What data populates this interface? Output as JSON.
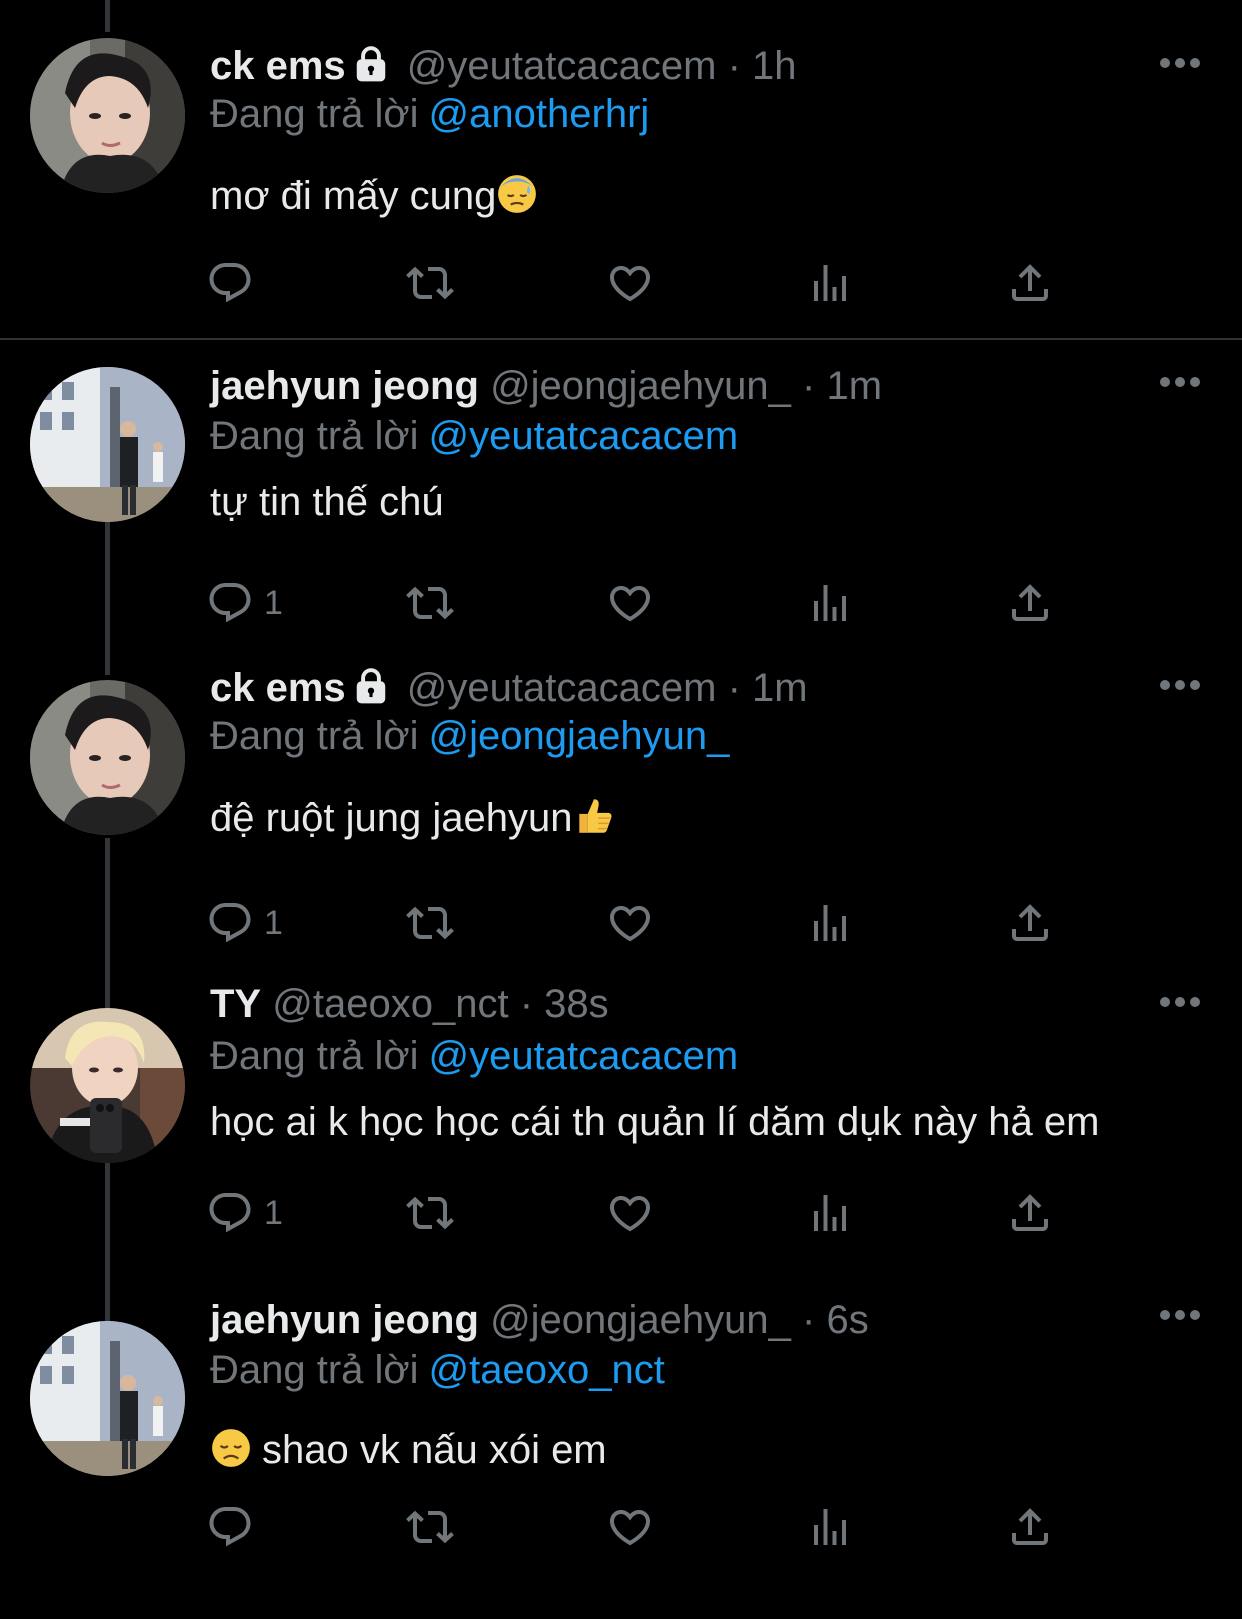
{
  "tweets": [
    {
      "name": "ck ems",
      "locked": true,
      "handle": "@yeutatcacacem",
      "sep": "·",
      "time": "1h",
      "reply_prefix": "Đang trả lời",
      "reply_to": "@anotherhrj",
      "text": "mơ đi mấy cung",
      "emoji": "sweat-face",
      "reply_count": ""
    },
    {
      "name": "jaehyun jeong",
      "locked": false,
      "handle": "@jeongjaehyun_",
      "sep": "·",
      "time": "1m",
      "reply_prefix": "Đang trả lời",
      "reply_to": "@yeutatcacacem",
      "text": "tự tin thế chú",
      "emoji": "",
      "reply_count": "1"
    },
    {
      "name": "ck ems",
      "locked": true,
      "handle": "@yeutatcacacem",
      "sep": "·",
      "time": "1m",
      "reply_prefix": "Đang trả lời",
      "reply_to": "@jeongjaehyun_",
      "text": "đệ ruột jung jaehyun",
      "emoji": "thumbs-up",
      "reply_count": "1"
    },
    {
      "name": "TY",
      "locked": false,
      "handle": "@taeoxo_nct",
      "sep": "·",
      "time": "38s",
      "reply_prefix": "Đang trả lời",
      "reply_to": "@yeutatcacacem",
      "text": "học ai k học học cái th quản lí dăm dụk này hả em",
      "emoji": "",
      "reply_count": "1"
    },
    {
      "name": "jaehyun jeong",
      "locked": false,
      "handle": "@jeongjaehyun_",
      "sep": "·",
      "time": "6s",
      "reply_prefix": "Đang trả lời",
      "reply_to": "@taeoxo_nct",
      "text": "shao vk nấu xói em",
      "emoji": "disappointed-face",
      "reply_count": ""
    }
  ],
  "icons": {
    "reply": "reply-icon",
    "retweet": "retweet-icon",
    "like": "heart-icon",
    "views": "views-icon",
    "share": "share-icon",
    "more": "more-icon",
    "lock": "lock-icon"
  },
  "colors": {
    "background": "#000000",
    "primary_text": "#e7e9ea",
    "secondary_text": "#71767b",
    "mention": "#1d9bf0",
    "thread_line": "#333639"
  }
}
